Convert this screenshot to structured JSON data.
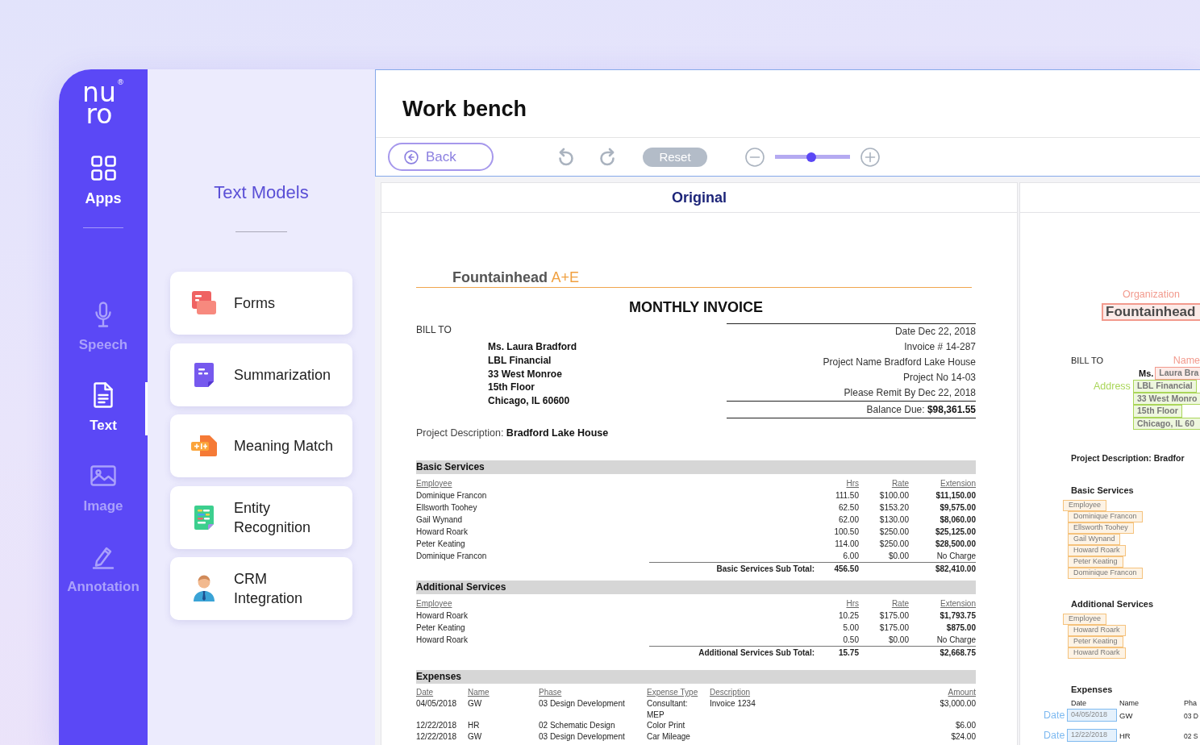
{
  "sidebar": {
    "logo": {
      "lines": [
        "nu",
        "ro"
      ],
      "mark": "®"
    },
    "apps": {
      "label": "Apps"
    },
    "items": [
      {
        "label": "Speech",
        "selected": false
      },
      {
        "label": "Text",
        "selected": true
      },
      {
        "label": "Image",
        "selected": false
      },
      {
        "label": "Annotation",
        "selected": false
      }
    ]
  },
  "models_panel": {
    "title": "Text Models",
    "items": [
      {
        "label": "Forms"
      },
      {
        "label": "Summarization"
      },
      {
        "label": "Meaning Match"
      },
      {
        "label": "Entity Recognition"
      },
      {
        "label": "CRM Integration"
      }
    ]
  },
  "workbench": {
    "title": "Work bench",
    "toolbar": {
      "back": "Back",
      "undo": {
        "disabled": true
      },
      "redo": {
        "disabled": true
      },
      "reset": {
        "label": "Reset",
        "disabled": true
      },
      "zoom": {
        "level": 0.48
      }
    }
  },
  "original": {
    "title": "Original",
    "invoice": {
      "company": {
        "name": "Fountainhead",
        "suffix": "A+E"
      },
      "title": "MONTHLY INVOICE",
      "bill_to": {
        "label": "BILL TO",
        "lines": [
          "Ms. Laura Bradford",
          "LBL Financial",
          "33 West Monroe",
          "15th Floor",
          "Chicago, IL 60600"
        ]
      },
      "details": [
        "Date Dec 22, 2018",
        "Invoice # 14-287",
        "Project Name Bradford Lake House",
        "Project No 14-03",
        "Please Remit By Dec 22, 2018"
      ],
      "balance": "Balance Due: **$98,361.55**",
      "project_description": "Project Description: **Bradford Lake House**",
      "sections": [
        {
          "title": "Basic Services",
          "columns": [
            "Employee",
            "Hrs",
            "Rate",
            "Extension"
          ],
          "rows": [
            {
              "employee": "Dominique Francon",
              "hours": "111.50",
              "rate": "$100.00",
              "extension": "$11,150.00",
              "charged": true
            },
            {
              "employee": "Ellsworth Toohey",
              "hours": "62.50",
              "rate": "$153.20",
              "extension": "$9,575.00",
              "charged": true
            },
            {
              "employee": "Gail Wynand",
              "hours": "62.00",
              "rate": "$130.00",
              "extension": "$8,060.00",
              "charged": true
            },
            {
              "employee": "Howard Roark",
              "hours": "100.50",
              "rate": "$250.00",
              "extension": "$25,125.00",
              "charged": true
            },
            {
              "employee": "Peter Keating",
              "hours": "114.00",
              "rate": "$250.00",
              "extension": "$28,500.00",
              "charged": true
            },
            {
              "employee": "Dominique Francon",
              "hours": "6.00",
              "rate": "$0.00",
              "extension": "No Charge",
              "charged": false
            }
          ],
          "subtotal": {
            "label": "Basic Services Sub Total:",
            "hours": "456.50",
            "extension": "$82,410.00"
          }
        },
        {
          "title": "Additional Services",
          "columns": [
            "Employee",
            "Hrs",
            "Rate",
            "Extension"
          ],
          "rows": [
            {
              "employee": "Howard Roark",
              "hours": "10.25",
              "rate": "$175.00",
              "extension": "$1,793.75",
              "charged": true
            },
            {
              "employee": "Peter Keating",
              "hours": "5.00",
              "rate": "$175.00",
              "extension": "$875.00",
              "charged": true
            },
            {
              "employee": "Howard Roark",
              "hours": "0.50",
              "rate": "$0.00",
              "extension": "No Charge",
              "charged": false
            }
          ],
          "subtotal": {
            "label": "Additional Services Sub Total:",
            "hours": "15.75",
            "extension": "$2,668.75"
          }
        }
      ],
      "expenses": {
        "title": "Expenses",
        "columns": [
          "Date",
          "Name",
          "Phase",
          "Expense Type",
          "Description",
          "Amount"
        ],
        "rows": [
          {
            "date": "04/05/2018",
            "name": "GW",
            "phase": "03 Design Development",
            "type": "Consultant: MEP",
            "description": "Invoice 1234",
            "amount": "$3,000.00"
          },
          {
            "date": "12/22/2018",
            "name": "HR",
            "phase": "02 Schematic Design",
            "type": "Color Print",
            "amount": "$6.00"
          },
          {
            "date": "12/22/2018",
            "name": "GW",
            "phase": "03 Design Development",
            "type": "Car Mileage",
            "amount": "$24.00"
          }
        ]
      }
    }
  },
  "annotated": {
    "organization": {
      "tag": "Organization",
      "text": "Fountainhead",
      "color": "#f29a8d",
      "clipped": true
    },
    "bill_to": "BILL TO",
    "name": {
      "tag": "Name",
      "prefix": "Ms.",
      "text": "Laura Bra",
      "color": "#f29a8d",
      "clipped": true
    },
    "address": {
      "tag": "Address",
      "color": "#aad65a",
      "lines": [
        {
          "text": "LBL Financial",
          "clipped": false
        },
        {
          "text": "33 West Monro",
          "clipped": true
        },
        {
          "text": "15th Floor",
          "clipped": false
        },
        {
          "text": "Chicago, IL 60",
          "clipped": true
        }
      ]
    },
    "project_description": "Project Description: Bradfor",
    "sections": [
      {
        "title": "Basic Services",
        "color": "#f5c27c",
        "entries": [
          "Employee",
          "Dominique Francon",
          "Ellsworth Toohey",
          "Gail Wynand",
          "Howard Roark",
          "Peter Keating",
          "Dominique Francon"
        ]
      },
      {
        "title": "Additional Services",
        "color": "#f5c27c",
        "entries": [
          "Employee",
          "Howard Roark",
          "Peter Keating",
          "Howard Roark"
        ]
      }
    ],
    "expenses": {
      "title": "Expenses",
      "columns": [
        "Date",
        "Name",
        "Pha"
      ],
      "color": "#7fbaf0",
      "rows": [
        {
          "tag": "Date",
          "date": "04/05/2018",
          "name": "GW",
          "phase": "03 D"
        },
        {
          "tag": "Date",
          "date": "12/22/2018",
          "name": "HR",
          "phase": "02 S"
        }
      ]
    }
  }
}
